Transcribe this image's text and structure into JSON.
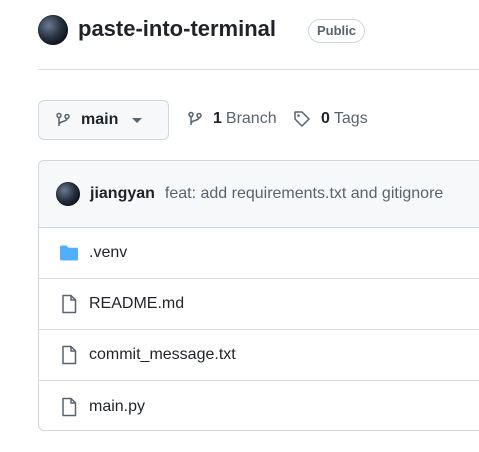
{
  "repo": {
    "name": "paste-into-terminal",
    "visibility": "Public"
  },
  "branch_bar": {
    "current_branch": "main",
    "branch_count": "1",
    "branch_label": "Branch",
    "tag_count": "0",
    "tag_label": "Tags"
  },
  "latest_commit": {
    "author": "jiangyan",
    "message": "feat: add requirements.txt and gitignore"
  },
  "files": [
    {
      "name": ".venv",
      "icon": "folder-icon"
    },
    {
      "name": "README.md",
      "icon": "file-icon"
    },
    {
      "name": "commit_message.txt",
      "icon": "file-icon"
    },
    {
      "name": "main.py",
      "icon": "file-icon"
    }
  ],
  "colors": {
    "folder": "#54aeff",
    "muted": "#59636e",
    "border": "#d0d7de"
  }
}
